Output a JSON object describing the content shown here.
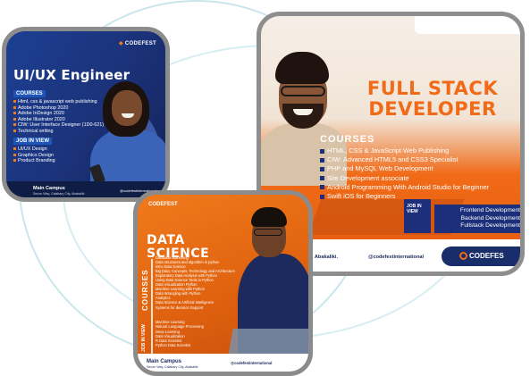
{
  "uiux": {
    "logo": "CODEFEST",
    "title": "UI/UX Engineer",
    "courses_label": "COURSES",
    "courses": [
      "Html, css & javascript web publishing",
      "Adobe Photoshop 2020",
      "Adobe InDesign 2020",
      "Adobe Illustrator 2020",
      "CIW: User Interface Designer (1D0-621)",
      "Technical writing"
    ],
    "jobs_label": "JOB IN VIEW",
    "jobs": [
      "UI/UX Design",
      "Graphics Design",
      "Product Branding"
    ],
    "footer_campus": "Main Campus",
    "footer_address": "Secon Way, Calabary City, Abakaliki",
    "footer_social": "@codefestinternational"
  },
  "fullstack": {
    "title_line1": "FULL STACK",
    "title_line2": "DEVELOPER",
    "courses_label": "COURSES",
    "courses": [
      "HTML, CSS & JavaScript Web Publishing",
      "CIW: Advanced HTML5 and CSS3 Specialist",
      "PHP and MySQL Web Development",
      "Site Development associate",
      "Android Programming With Android Studio for Beginner",
      "Swift iOS for Beginners"
    ],
    "job_badge": "JOB IN VIEW",
    "jobs": [
      "Frontend Development",
      "Backend Development",
      "Fullstack Development"
    ],
    "address": "ry City, Abakaliki.",
    "social": "@codefestinternational",
    "logo": "CODEFES"
  },
  "datasci": {
    "logo": "CODEFEST",
    "title_line1": "DATA",
    "title_line2": "SCIENCE",
    "courses_label": "COURSES",
    "courses": [
      "Database Marketing",
      "Data structures and algorithm in python",
      "Intro Data Science",
      "Big Data: Concepts, Technology and Architecture",
      "Exploratory Data Analysis with Python",
      "Using Data Science Tools in Python",
      "Data Visualization Python",
      "Machine Learning with Python",
      "Data Wrangling with Python",
      "Analytics",
      "Data Science & Artificial Intelligence",
      "Systems for decision Support"
    ],
    "jobs_label": "JOB IN VIEW",
    "jobs": [
      "Machine Learning",
      "Natural Language Processing",
      "Deep Learning",
      "Data Visualization",
      "R Data Scientist",
      "Python Data Scientist"
    ],
    "footer_campus": "Main Campus",
    "footer_address": "Secon Way, Calabary City, Abakaliki",
    "footer_social": "@codefestinternational"
  }
}
